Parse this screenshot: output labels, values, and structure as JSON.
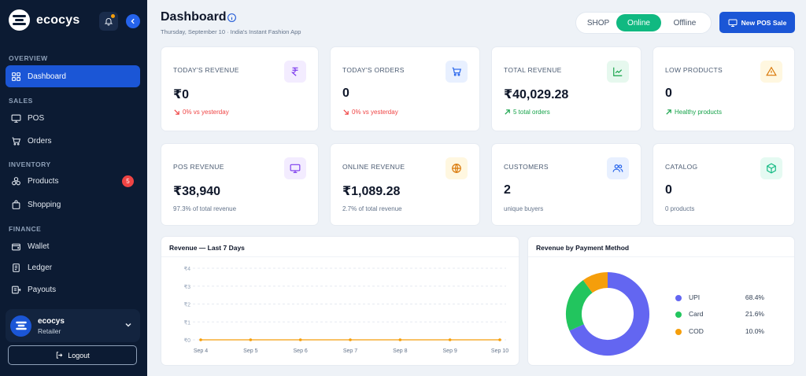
{
  "app": {
    "name": "ecocys"
  },
  "sidebar": {
    "sections": {
      "overview": "OVERVIEW",
      "sales": "SALES",
      "inventory": "INVENTORY",
      "finance": "FINANCE"
    },
    "items": [
      {
        "label": "Dashboard",
        "icon": "grid-icon",
        "active": true
      },
      {
        "label": "POS",
        "icon": "monitor-icon"
      },
      {
        "label": "Orders",
        "icon": "cart-icon"
      },
      {
        "label": "Products",
        "icon": "products-icon",
        "badge": "5"
      },
      {
        "label": "Shopping",
        "icon": "bag-icon"
      },
      {
        "label": "Wallet",
        "icon": "wallet-icon"
      },
      {
        "label": "Ledger",
        "icon": "ledger-icon"
      },
      {
        "label": "Payouts",
        "icon": "payouts-icon"
      }
    ],
    "user": {
      "name": "ecocys",
      "role": "Retailer"
    },
    "logout_label": "Logout"
  },
  "header": {
    "title": "Dashboard",
    "subtitle": "Thursday, September 10 · India's Instant Fashion App",
    "mode": {
      "shop": "SHOP",
      "online": "Online",
      "offline": "Offline",
      "selected": "Online"
    },
    "new_pos_label": "New POS Sale"
  },
  "stats": [
    {
      "label": "TODAY'S REVENUE",
      "value": "₹0",
      "sub": "0% vs yesterday",
      "trend": "down",
      "icon": "rupee-icon",
      "color": "#7c3aed"
    },
    {
      "label": "TODAY'S ORDERS",
      "value": "0",
      "sub": "0% vs yesterday",
      "trend": "down",
      "icon": "cart-icon",
      "color": "#2563eb"
    },
    {
      "label": "TOTAL REVENUE",
      "value": "₹40,029.28",
      "sub": "5 total orders",
      "trend": "up",
      "icon": "trend-chart-icon",
      "color": "#16a34a"
    },
    {
      "label": "LOW PRODUCTS",
      "value": "0",
      "sub": "Healthy products",
      "trend": "up",
      "icon": "warning-icon",
      "color": "#d97706"
    },
    {
      "label": "POS REVENUE",
      "value": "₹38,940",
      "sub": "97.3% of total revenue",
      "trend": "none",
      "icon": "monitor-icon",
      "color": "#7c3aed"
    },
    {
      "label": "ONLINE REVENUE",
      "value": "₹1,089.28",
      "sub": "2.7% of total revenue",
      "trend": "none",
      "icon": "globe-icon",
      "color": "#d97706"
    },
    {
      "label": "CUSTOMERS",
      "value": "2",
      "sub": "unique buyers",
      "trend": "none",
      "icon": "users-icon",
      "color": "#2563eb"
    },
    {
      "label": "CATALOG",
      "value": "0",
      "sub": "0 products",
      "trend": "none",
      "icon": "box-icon",
      "color": "#10b981"
    }
  ],
  "revenue_panel": {
    "title": "Revenue — Last 7 Days"
  },
  "payment_panel": {
    "title": "Revenue by Payment Method"
  },
  "chart_data": [
    {
      "type": "line",
      "title": "Revenue — Last 7 Days",
      "categories": [
        "Sep 4",
        "Sep 5",
        "Sep 6",
        "Sep 7",
        "Sep 8",
        "Sep 9",
        "Sep 10"
      ],
      "values": [
        0,
        0,
        0,
        0,
        0,
        0,
        0
      ],
      "ylim": [
        0,
        4
      ],
      "yticks": [
        "₹0",
        "₹1",
        "₹2",
        "₹3",
        "₹4"
      ],
      "grid": true,
      "color": "#f59e0b"
    },
    {
      "type": "pie",
      "title": "Revenue by Payment Method",
      "donut": true,
      "labels": [
        "UPI",
        "Card",
        "COD"
      ],
      "values": [
        68.4,
        21.6,
        10.0
      ],
      "value_labels": [
        "68.4%",
        "21.6%",
        "10.0%"
      ],
      "colors": [
        "#6366f1",
        "#22c55e",
        "#f59e0b"
      ],
      "legend": "right"
    }
  ]
}
